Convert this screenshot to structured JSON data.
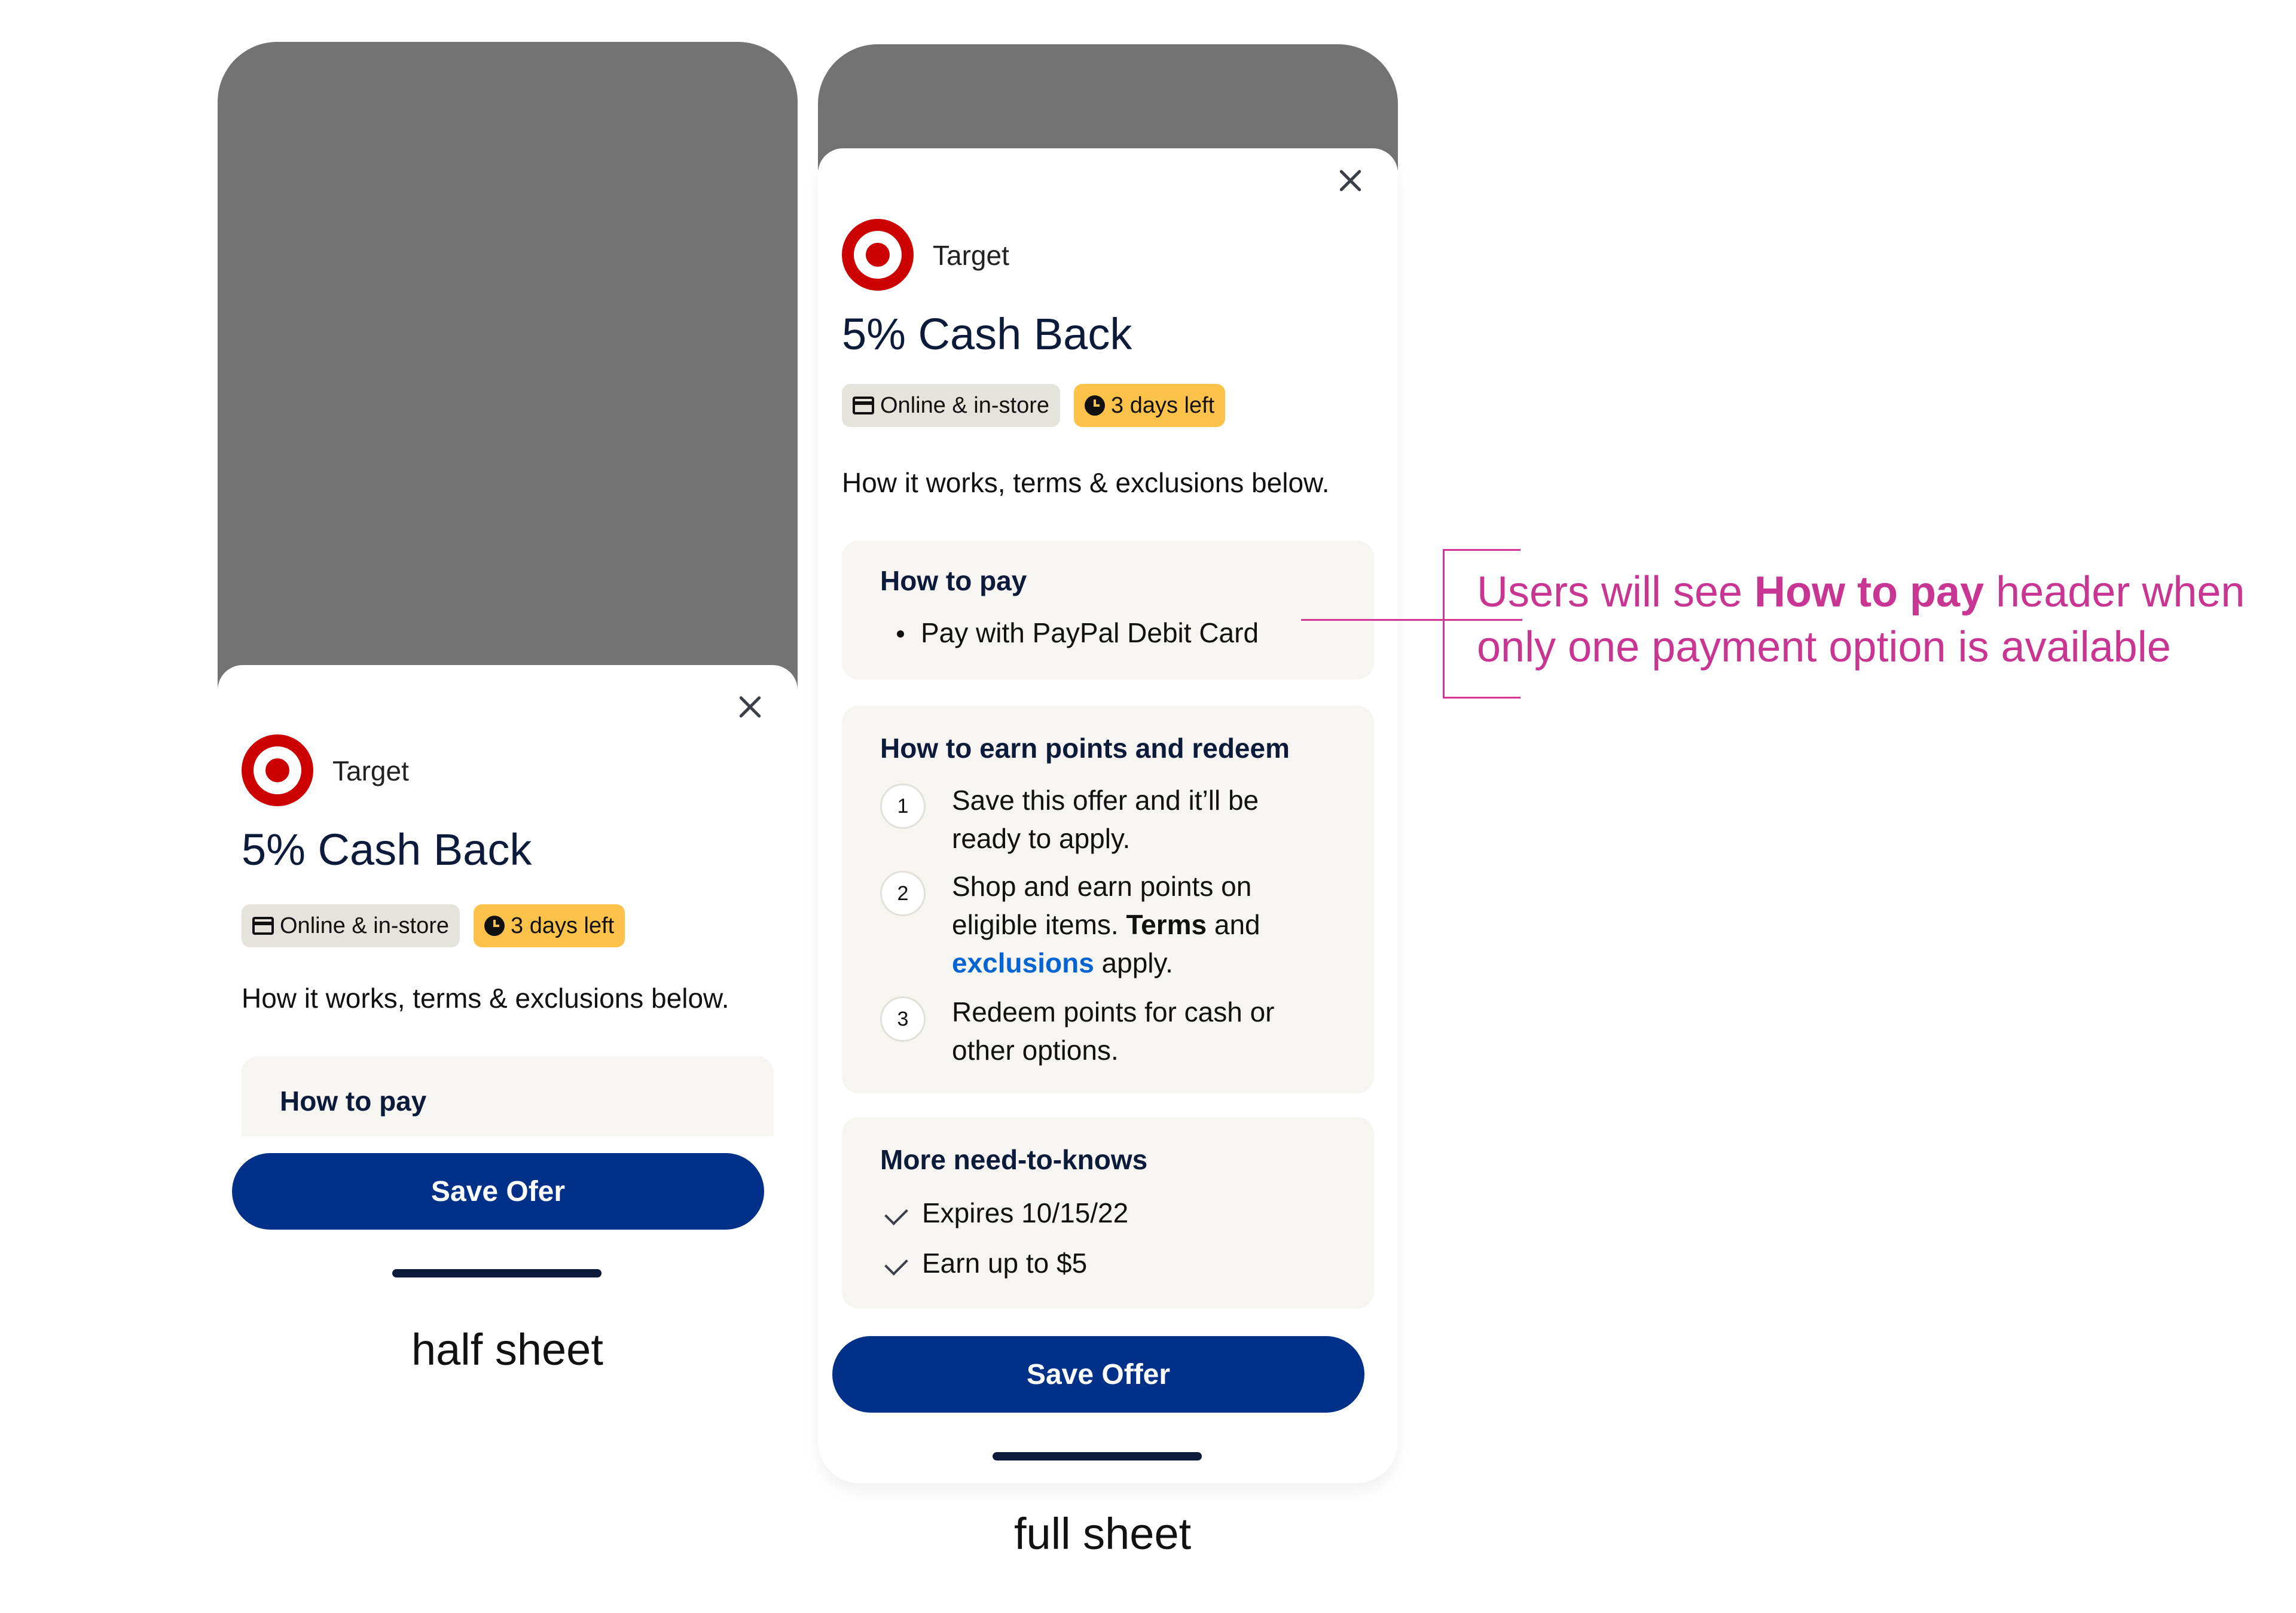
{
  "offer": {
    "merchant": "Target",
    "title": "5% Cash Back",
    "chip_channel": "Online & in-store",
    "chip_expiry": "3 days left",
    "description": "How it works, terms & exclusions below."
  },
  "how_to_pay": {
    "heading": "How to pay",
    "bullet": "Pay with PayPal Debit Card"
  },
  "how_to_earn": {
    "heading": "How to earn points and redeem",
    "steps": [
      {
        "number": "1",
        "line1": "Save this offer and it’ll be",
        "line2": "ready to apply."
      },
      {
        "number": "2",
        "line1": "Shop and earn points on",
        "line2_prefix": "eligible items. ",
        "terms_label": "Terms",
        "line2_suffix": " and",
        "exclusions_label": "exclusions",
        "line3_suffix": " apply."
      },
      {
        "number": "3",
        "line1": "Redeem points for cash or",
        "line2": "other options."
      }
    ]
  },
  "need_to_knows": {
    "heading": "More need-to-knows",
    "items": [
      "Expires 10/15/22",
      "Earn up to $5"
    ]
  },
  "buttons": {
    "half_save": "Save Ofer",
    "full_save": "Save Offer"
  },
  "captions": {
    "half": "half sheet",
    "full": "full sheet"
  },
  "annotation": {
    "prefix": "Users will see ",
    "bold": "How to pay",
    "suffix": " header when",
    "line2": "only one payment option is available"
  },
  "colors": {
    "brand_red": "#cc0000",
    "button_blue": "#003087",
    "annotation_pink": "#c93592",
    "link_blue": "#0064d2",
    "chip_yellow": "#fdc24a",
    "backdrop_grey": "#737373"
  }
}
